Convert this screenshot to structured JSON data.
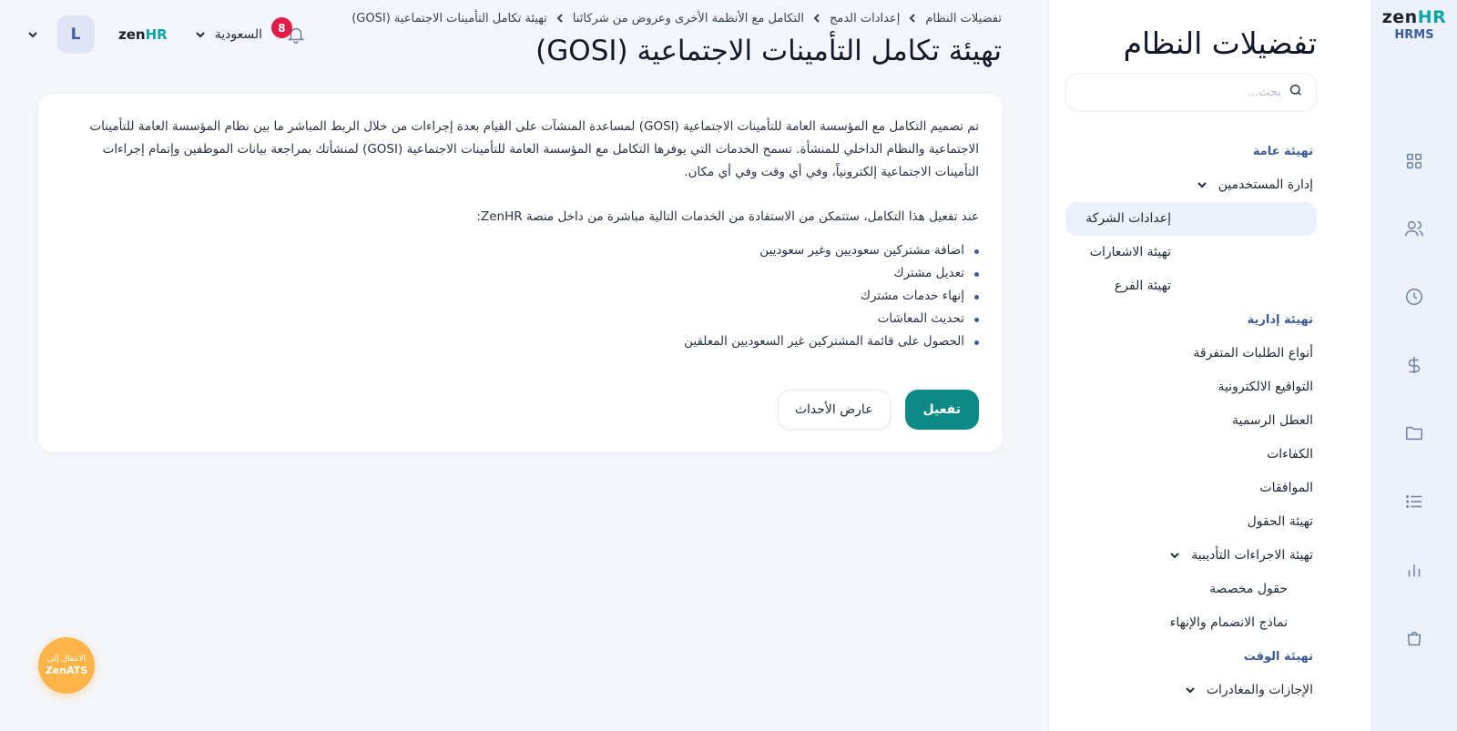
{
  "brand": {
    "logo_text": "zenHR",
    "sub": "HRMS"
  },
  "rail_icons": [
    "grid-icon",
    "users-icon",
    "clock-icon",
    "dollar-icon",
    "folder-icon",
    "list-icon",
    "bar-chart-icon",
    "shopping-bag-icon"
  ],
  "sidebar": {
    "title": "تفضيلات النظام",
    "search_placeholder": "بحث...",
    "sections": [
      {
        "label": "تهيئة عامة",
        "items": [
          {
            "label": "إدارة المستخدمين",
            "has_chevron": true
          },
          {
            "label": "إعدادات الشركة",
            "active": true
          },
          {
            "label": "تهيئة الاشعارات"
          },
          {
            "label": "تهيئة الفرع"
          }
        ]
      },
      {
        "label": "تهيئة إدارية",
        "items": [
          {
            "label": "أنواع الطلبات المتفرقة"
          },
          {
            "label": "التواقيع الالكترونية"
          },
          {
            "label": "العطل الرسمية"
          },
          {
            "label": "الكفاءات"
          },
          {
            "label": "الموافقات"
          },
          {
            "label": "تهيئة الحقول"
          },
          {
            "label": "تهيئة الاجراءات التأديبية",
            "has_chevron": true
          },
          {
            "label": "حقول مخصصة"
          },
          {
            "label": "نماذج الانضمام والإنهاء"
          }
        ]
      },
      {
        "label": "تهيئة الوقت",
        "items": [
          {
            "label": "الإجازات والمغادرات",
            "has_chevron": true
          }
        ]
      }
    ]
  },
  "topbar": {
    "avatar_initial": "L",
    "company_logo": "zenHR",
    "country": "السعودية",
    "notification_count": "8"
  },
  "breadcrumb": [
    "تفضيلات النظام",
    "إعدادات الدمج",
    "التكامل مع الأنظمة الأخرى وعروض من شركائنا",
    "تهيئة تكامل التأمينات الاجتماعية (GOSI)"
  ],
  "page_title": "تهيئة تكامل التأمينات الاجتماعية (GOSI)",
  "card": {
    "paragraph1": "تم تصميم التكامل مع المؤسسة العامة للتأمينات الاجتماعية (GOSI) لمساعدة المنشآت على القيام بعدة إجراءات من خلال الربط المباشر ما بين نظام المؤسسة العامة للتأمينات الاجتماعية والنظام الداخلي للمنشأة. تسمح الخدمات التي يوفرها التكامل مع المؤسسة العامة للتأمينات الاجتماعية (GOSI) لمنشأتك بمراجعة بيانات الموظفين وإتمام إجراءات التأمينات الاجتماعية إلكترونياً، وفي أي وقت وفي أي مكان.",
    "paragraph2": "عند تفعيل هذا التكامل، ستتمكن من الاستفادة من الخدمات التالية مباشرة من داخل منصة ZenHR:",
    "services": [
      "اضافة مشتركين سعوديين وغير سعوديين",
      "تعديل مشترك",
      "إنهاء خدمات مشترك",
      "تحديث المعاشات",
      "الحصول على قائمة المشتركين غير السعوديين المعلقين"
    ],
    "activate_label": "تفعيل",
    "event_viewer_label": "عارض الأحداث"
  },
  "zenats": {
    "line1": "الانتقال إلى",
    "line2": "ZenATS"
  },
  "colors": {
    "accent": "#0e8a86",
    "section": "#3b5b9b",
    "badge": "#e11d48",
    "zenats": "#fdb54a"
  }
}
